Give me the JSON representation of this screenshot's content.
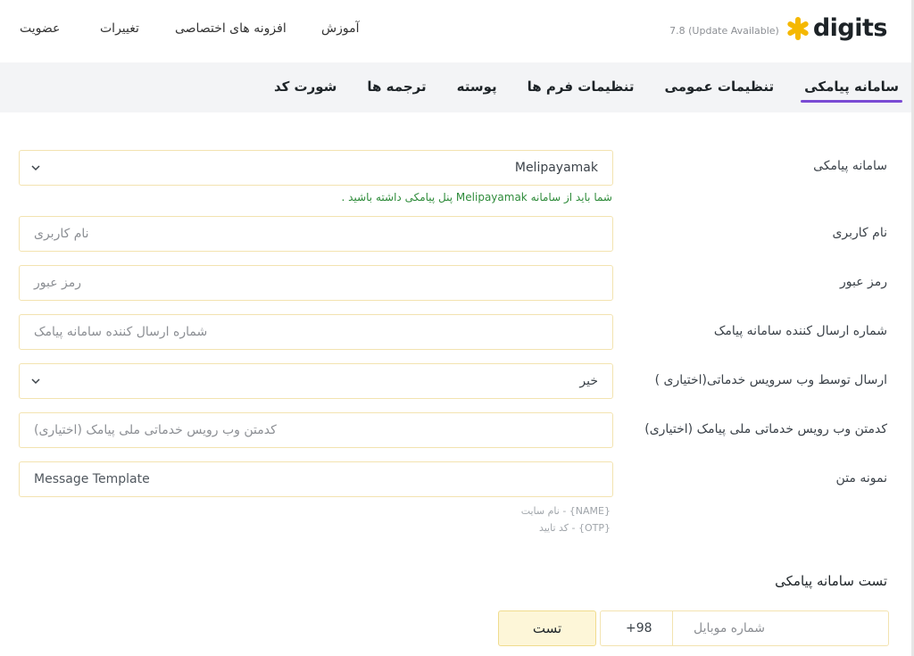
{
  "header": {
    "brand": "digits",
    "version": "7.8 (Update Available)",
    "nav": [
      "عضویت",
      "تغییرات",
      "افزونه های اختصاصی",
      "آموزش"
    ]
  },
  "tabs": [
    "سامانه پیامکی",
    "تنظیمات عمومی",
    "تنظیمات فرم ها",
    "پوسته",
    "ترجمه ها",
    "شورت کد"
  ],
  "active_tab": "سامانه پیامکی",
  "colors": {
    "accent": "#7a4bd4",
    "field_border": "#f3e3b0",
    "note_green": "#2e8b3a",
    "brand_star": "#f5b800"
  },
  "form": {
    "gateway": {
      "label": "سامانه پیامکی",
      "value": "Melipayamak",
      "note": "شما باید از سامانه Melipayamak پنل پیامکی داشته باشید ."
    },
    "username": {
      "label": "نام کاربری",
      "placeholder": "نام کاربری"
    },
    "password": {
      "label": "رمز عبور",
      "placeholder": "رمز عبور"
    },
    "sender": {
      "label": "شماره ارسال کننده سامانه پیامک",
      "placeholder": "شماره ارسال کننده سامانه پیامک"
    },
    "webservice": {
      "label": "ارسال توسط وب سرویس خدماتی(اختیاری )",
      "value": "خیر"
    },
    "webservice_text": {
      "label": "کدمتن وب رویس خدماتی ملی پیامک (اختیاری)",
      "placeholder": "کدمتن وب رویس خدماتی ملی پیامک (اختیاری)"
    },
    "template": {
      "label": "نمونه متن",
      "value": "Message Template",
      "hints": [
        "نام سایت - {NAME}",
        "کد تایید - {OTP}"
      ]
    }
  },
  "test": {
    "title": "تست سامانه پیامکی",
    "mobile_placeholder": "شماره موبایل",
    "country_code": "+98",
    "button": "تست"
  }
}
